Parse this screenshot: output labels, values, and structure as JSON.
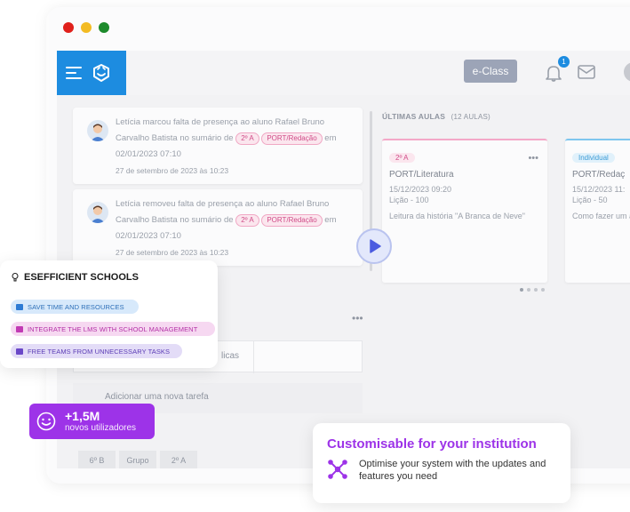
{
  "app": {
    "eclass_label": "e-Class",
    "notification_count": "1"
  },
  "notifications": [
    {
      "line1": "Letícia marcou falta de presença ao aluno Rafael Bruno",
      "line2_pre": "Carvalho Batista no sumário de",
      "chip1": "2º A",
      "chip2": "PORT/Redação",
      "line2_post": "em",
      "line3": "02/01/2023 07:10",
      "date": "27 de setembro de 2023 às 10:23"
    },
    {
      "line1": "Letícia removeu falta de presença ao aluno Rafael Bruno",
      "line2_pre": "Carvalho Batista no sumário de",
      "chip1": "2º A",
      "chip2": "PORT/Redação",
      "line2_post": "em",
      "line3": "02/01/2023 07:10",
      "date": "27 de setembro de 2023 às 10:23"
    }
  ],
  "lessons": {
    "title": "ÚLTIMAS AULAS",
    "count": "(12 AULAS)",
    "cards": [
      {
        "chip": "2º A",
        "title": "PORT/Literatura",
        "datetime": "15/12/2023 09:20",
        "lesson": "Lição - 100",
        "desc": "Leitura da história \"A Branca de Neve\""
      },
      {
        "chip": "Individual",
        "title": "PORT/Redaç",
        "datetime": "15/12/2023 11:",
        "lesson": "Lição - 50",
        "desc": "Como fazer um argumentativ"
      }
    ]
  },
  "tasks": {
    "tab_partial": "licas",
    "add_task": "Adicionar uma nova tarefa",
    "filters": [
      "6º B",
      "Grupo",
      "2º A"
    ]
  },
  "efficient": {
    "title": "ESEFFICIENT SCHOOLS",
    "pills": [
      "SAVE TIME AND RESOURCES",
      "INTEGRATE THE LMS WITH SCHOOL MANAGEMENT",
      "FREE TEAMS FROM UNNECESSARY TASKS"
    ]
  },
  "users": {
    "number": "+1,5M",
    "label": "novos utilizadores"
  },
  "custom": {
    "title": "Customisable for your institution",
    "text": "Optimise your system with the updates and features you need"
  },
  "colors": {
    "brand_blue": "#1d8ce0",
    "brand_purple": "#9d33e8",
    "chip_pink": "#d04c88"
  }
}
